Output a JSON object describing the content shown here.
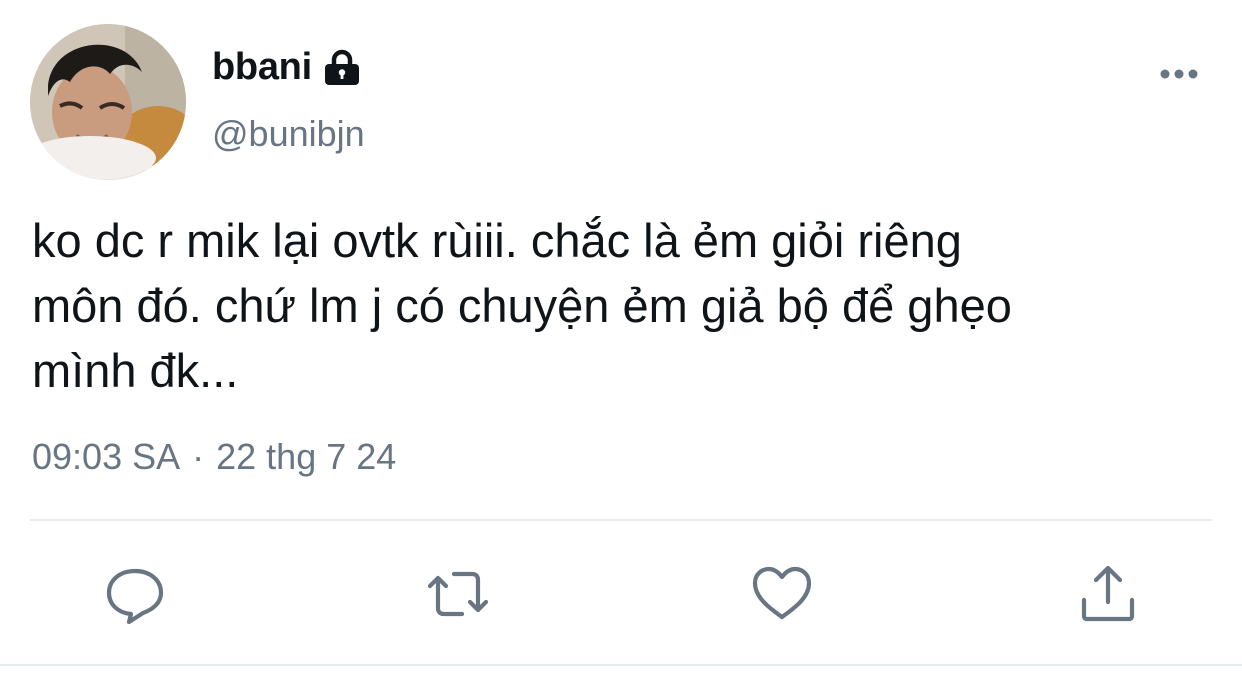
{
  "user": {
    "display_name": "bbani",
    "handle": "@bunibjn",
    "protected_icon": "lock-icon"
  },
  "tweet": {
    "text": "ko dc r mik lại ovtk rùiii. chắc là ẻm giỏi riêng\nmôn đó. chứ lm j có chuyện ẻm giả bộ để ghẹo\nmình đk...",
    "time": "09:03 SA",
    "separator": "·",
    "date": "22 thg 7 24"
  },
  "actions": [
    {
      "name": "reply",
      "icon": "comment-bubble-icon"
    },
    {
      "name": "retweet",
      "icon": "retweet-arrows-icon"
    },
    {
      "name": "like",
      "icon": "heart-icon"
    },
    {
      "name": "share",
      "icon": "share-upload-icon"
    }
  ],
  "colors": {
    "text": "#0f1419",
    "secondary": "#687684",
    "divider": "#e6ecf0"
  }
}
